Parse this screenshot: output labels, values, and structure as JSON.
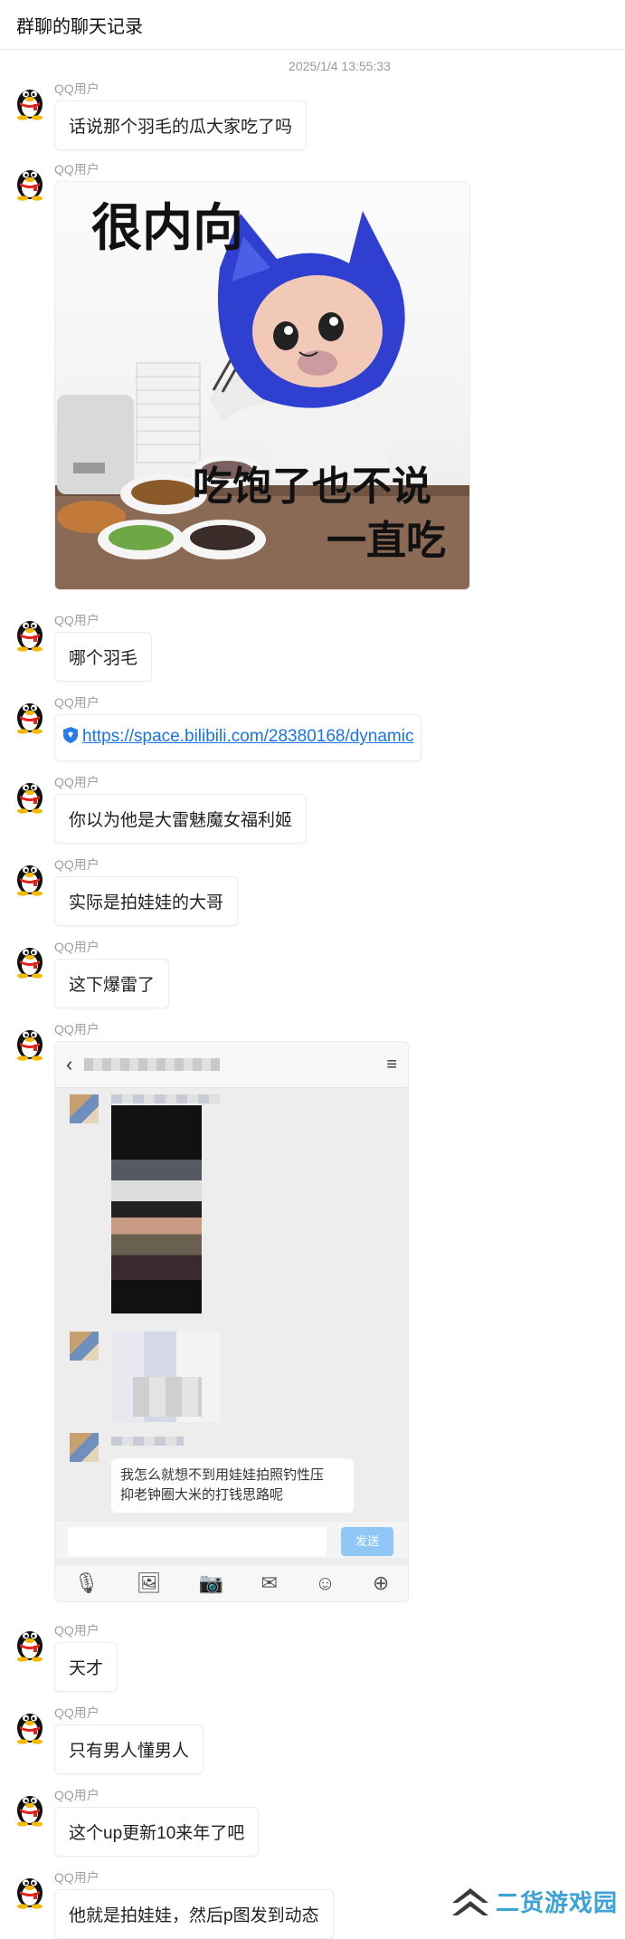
{
  "header": {
    "title": "群聊的聊天记录"
  },
  "timestamp": "2025/1/4 13:55:33",
  "sender_name": "QQ用户",
  "messages": [
    {
      "type": "text",
      "text": "话说那个羽毛的瓜大家吃了吗"
    },
    {
      "type": "image",
      "caption_top": "很内向",
      "caption_bottom_1": "吃饱了也不说",
      "caption_bottom_2": "一直吃"
    },
    {
      "type": "text",
      "text": "哪个羽毛"
    },
    {
      "type": "link",
      "text": "https://space.bilibili.com/28380168/dynamic"
    },
    {
      "type": "text",
      "text": "你以为他是大雷魅魔女福利姬"
    },
    {
      "type": "text",
      "text": "实际是拍娃娃的大哥"
    },
    {
      "type": "text",
      "text": "这下爆雷了"
    },
    {
      "type": "screenshot",
      "quote_line1": "我怎么就想不到用娃娃拍照钓性压",
      "quote_line2": "抑老钟圈大米的打钱思路呢",
      "send_label": "发送"
    },
    {
      "type": "text",
      "text": "天才"
    },
    {
      "type": "text",
      "text": "只有男人懂男人"
    },
    {
      "type": "text",
      "text": "这个up更新10来年了吧"
    },
    {
      "type": "text",
      "text": "他就是拍娃娃，然后p图发到动态"
    }
  ],
  "watermark": {
    "text": "二货游戏园"
  },
  "colors": {
    "link": "#1a73e8",
    "send_button": "#8fc8f7",
    "watermark": "#3ca2d6"
  }
}
